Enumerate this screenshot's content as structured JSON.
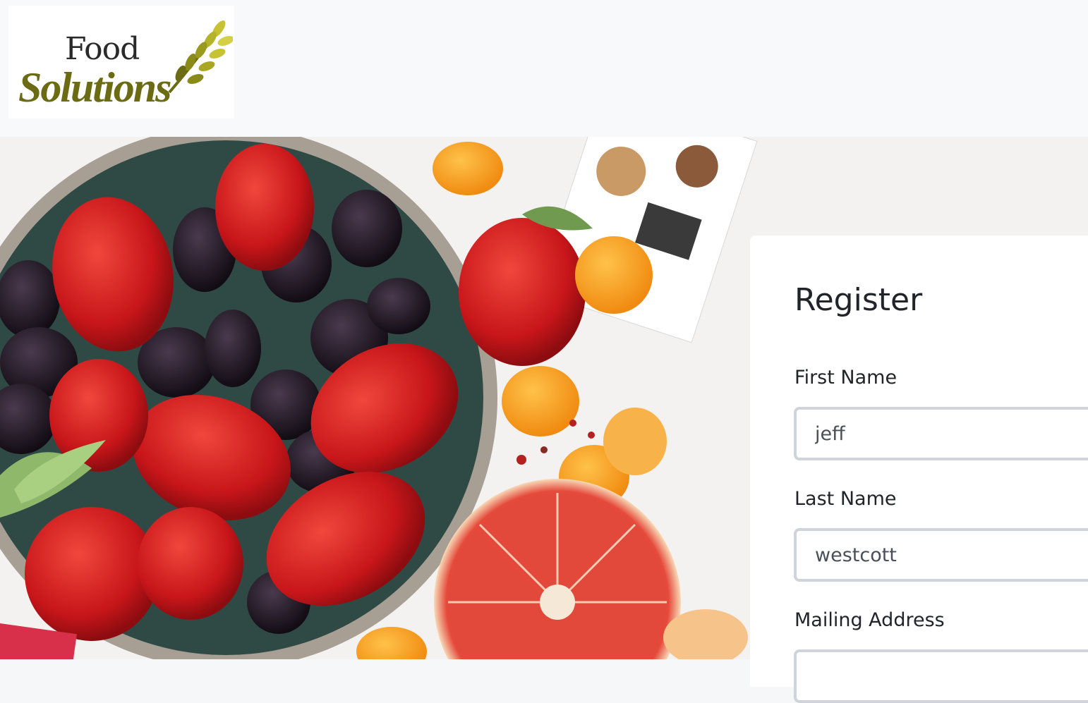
{
  "brand": {
    "line1": "Food",
    "line2": "Solutions"
  },
  "form": {
    "title": "Register",
    "fields": [
      {
        "label": "First Name",
        "value": "jeff"
      },
      {
        "label": "Last Name",
        "value": "westcott"
      },
      {
        "label": "Mailing Address",
        "value": ""
      }
    ]
  },
  "colors": {
    "navbar_bg": "#f8f9fa",
    "brand_green": "#6b6b14",
    "input_border": "#ced4da",
    "text": "#212529"
  }
}
